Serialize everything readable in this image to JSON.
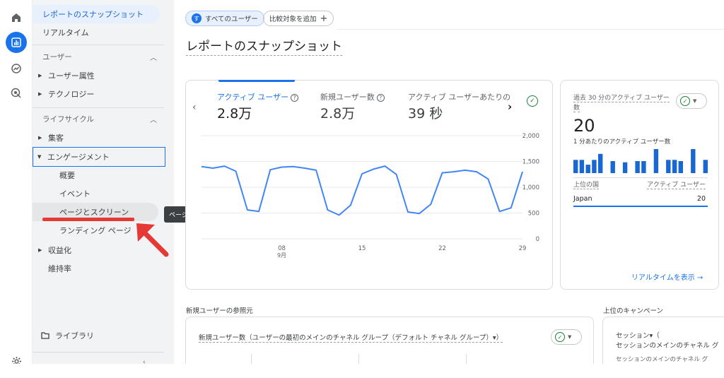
{
  "sidebar": {
    "top_items": [
      {
        "label": "レポートのスナップショット"
      },
      {
        "label": "リアルタイム"
      }
    ],
    "sections": [
      {
        "label": "ユーザー"
      },
      {
        "label": "ライフサイクル"
      }
    ],
    "user_items": [
      {
        "label": "ユーザー属性"
      },
      {
        "label": "テクノロジー"
      }
    ],
    "lifecycle_items": [
      {
        "label": "集客"
      },
      {
        "label": "エンゲージメント"
      },
      {
        "label": "概要"
      },
      {
        "label": "イベント"
      },
      {
        "label": "ページとスクリーン"
      },
      {
        "label": "ランディング ページ"
      },
      {
        "label": "収益化"
      },
      {
        "label": "維持率"
      }
    ],
    "library_label": "ライブラリ"
  },
  "tooltip": "ページとスクリーン",
  "header": {
    "all_users_badge": "す",
    "all_users_label": "すべてのユーザー",
    "compare_label": "比較対象を追加",
    "page_title": "レポートのスナップショット"
  },
  "metrics_card": {
    "metrics": [
      {
        "label": "アクティブ ユーザー",
        "value": "2.8万"
      },
      {
        "label": "新規ユーザー数",
        "value": "2.8万"
      },
      {
        "label": "アクティブ ユーザーあたりの",
        "value": "39 秒"
      }
    ],
    "question_mark": "?"
  },
  "realtime_card": {
    "title_line1": "過去 30 分のアクティブ ユーザー",
    "title_line2": "数",
    "value": "20",
    "per_min_label": "1 分あたりのアクティブ ユーザー数",
    "col_country": "上位の国",
    "col_users": "アクティブ ユーザー",
    "row_country": "Japan",
    "row_value": "20",
    "link": "リアルタイムを表示 →",
    "bars": [
      0.55,
      0.55,
      0.35,
      0.55,
      0.8,
      0,
      0.5,
      0,
      0.45,
      0,
      0.5,
      0.5,
      0,
      1.0,
      0,
      0.55,
      0.55,
      0.5,
      0,
      1.0,
      0,
      0.55
    ]
  },
  "bottom": {
    "new_users_section": "新規ユーザーの参照元",
    "campaign_section": "上位のキャンペーン",
    "new_users_card_title": "新規ユーザー数（ユーザーの最初のメインのチャネル グループ（デフォルト チャネル グループ）▾）",
    "campaign_line1": "セッション▾（",
    "campaign_line2": "セッションのメインのチャネル グ",
    "campaign_line3": "セッションのメインのチャネル グ"
  },
  "chart_data": {
    "type": "line",
    "series": [
      {
        "values": [
          1400,
          1370,
          1410,
          1310,
          560,
          530,
          1340,
          1390,
          1400,
          1370,
          1330,
          560,
          460,
          650,
          1260,
          1350,
          1410,
          1250,
          520,
          490,
          670,
          1280,
          1300,
          1330,
          1300,
          1160,
          530,
          600,
          1300
        ]
      }
    ],
    "x_tick_labels": [
      "08",
      "15",
      "22",
      "29"
    ],
    "x_sub_label": "9月",
    "y_tick_labels": [
      "2,000",
      "1,500",
      "1,000",
      "500",
      "0"
    ],
    "ylim": [
      0,
      2000
    ],
    "line_color": "#4285f4"
  }
}
